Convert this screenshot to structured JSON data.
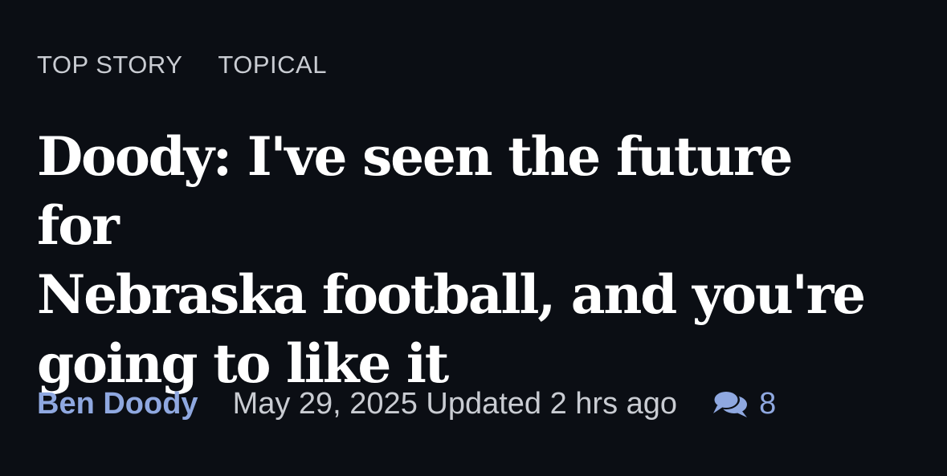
{
  "tags": [
    "TOP STORY",
    "TOPICAL"
  ],
  "headline": {
    "line1": "Doody: I've seen the future for",
    "line2": "Nebraska football, and you're",
    "line3": "going to like it"
  },
  "byline": {
    "author": "Ben Doody",
    "date": "May 29, 2025 Updated 2 hrs ago",
    "comment_count": "8",
    "comment_icon": "comments-icon"
  },
  "colors": {
    "background": "#0b0e14",
    "headline": "#ffffff",
    "accent": "#8fa8e0",
    "muted": "#c9ccd2"
  }
}
